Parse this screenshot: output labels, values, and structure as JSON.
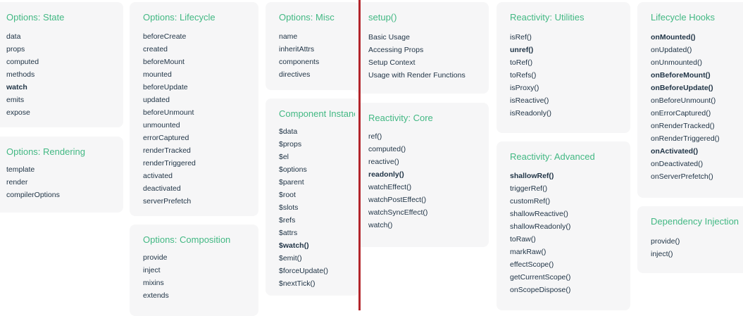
{
  "cards": {
    "options_state": {
      "title": "Options: State",
      "items": [
        "data",
        "props",
        "computed",
        "methods",
        "watch",
        "emits",
        "expose"
      ]
    },
    "options_rendering": {
      "title": "Options: Rendering",
      "items": [
        "template",
        "render",
        "compilerOptions"
      ]
    },
    "options_lifecycle": {
      "title": "Options: Lifecycle",
      "items": [
        "beforeCreate",
        "created",
        "beforeMount",
        "mounted",
        "beforeUpdate",
        "updated",
        "beforeUnmount",
        "unmounted",
        "errorCaptured",
        "renderTracked",
        "renderTriggered",
        "activated",
        "deactivated",
        "serverPrefetch"
      ]
    },
    "options_composition": {
      "title": "Options: Composition",
      "items": [
        "provide",
        "inject",
        "mixins",
        "extends"
      ]
    },
    "options_misc": {
      "title": "Options: Misc",
      "items": [
        "name",
        "inheritAttrs",
        "components",
        "directives"
      ]
    },
    "component_instance": {
      "title": "Component Instance",
      "items": [
        "$data",
        "$props",
        "$el",
        "$options",
        "$parent",
        "$root",
        "$slots",
        "$refs",
        "$attrs",
        "$watch()",
        "$emit()",
        "$forceUpdate()",
        "$nextTick()"
      ]
    },
    "setup": {
      "title": "setup()",
      "items": [
        "Basic Usage",
        "Accessing Props",
        "Setup Context",
        "Usage with Render Functions"
      ]
    },
    "reactivity_core": {
      "title": "Reactivity: Core",
      "items": [
        "ref()",
        "computed()",
        "reactive()",
        "readonly()",
        "watchEffect()",
        "watchPostEffect()",
        "watchSyncEffect()",
        "watch()"
      ]
    },
    "reactivity_utilities": {
      "title": "Reactivity: Utilities",
      "items": [
        "isRef()",
        "unref()",
        "toRef()",
        "toRefs()",
        "isProxy()",
        "isReactive()",
        "isReadonly()"
      ]
    },
    "reactivity_advanced": {
      "title": "Reactivity: Advanced",
      "items": [
        "shallowRef()",
        "triggerRef()",
        "customRef()",
        "shallowReactive()",
        "shallowReadonly()",
        "toRaw()",
        "markRaw()",
        "effectScope()",
        "getCurrentScope()",
        "onScopeDispose()"
      ]
    },
    "lifecycle_hooks": {
      "title": "Lifecycle Hooks",
      "items": [
        "onMounted()",
        "onUpdated()",
        "onUnmounted()",
        "onBeforeMount()",
        "onBeforeUpdate()",
        "onBeforeUnmount()",
        "onErrorCaptured()",
        "onRenderTracked()",
        "onRenderTriggered()",
        "onActivated()",
        "onDeactivated()",
        "onServerPrefetch()"
      ]
    },
    "dependency_injection": {
      "title": "Dependency Injection",
      "items": [
        "provide()",
        "inject()"
      ]
    }
  },
  "colors": {
    "title": "#42b883",
    "text": "#213547",
    "card_bg": "#f6f6f7",
    "divider": "#b3262c"
  }
}
